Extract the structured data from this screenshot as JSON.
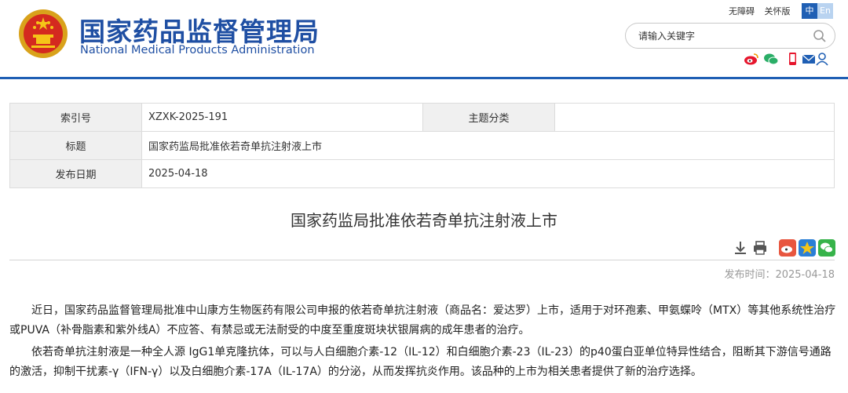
{
  "header": {
    "title_cn": "国家药品监督管理局",
    "title_en": "National Medical Products Administration",
    "emblem_icon": "national-emblem-icon",
    "links": [
      "无障碍",
      "关怀版"
    ],
    "lang_zh": "中",
    "lang_en": "En",
    "search_placeholder": "请输入关键字",
    "social_icons": [
      "weibo-icon",
      "wechat-icon",
      "mobile-icon",
      "mail-icon",
      "user-icon"
    ],
    "accent_color": "#1f5fb4"
  },
  "info": {
    "index_label": "索引号",
    "index_value": "XZXK-2025-191",
    "category_label": "主题分类",
    "category_value": "",
    "title_label": "标题",
    "title_value": "国家药监局批准依若奇单抗注射液上市",
    "date_label": "发布日期",
    "date_value": "2025-04-18"
  },
  "article": {
    "title": "国家药监局批准依若奇单抗注射液上市",
    "tool_icons": [
      "download-icon",
      "print-icon",
      "weibo-share-icon",
      "qzone-share-icon",
      "wechat-share-icon"
    ],
    "pub_date": "发布时间：2025-04-18",
    "paragraphs": [
      "近日，国家药品监督管理局批准中山康方生物医药有限公司申报的依若奇单抗注射液（商品名：爱达罗）上市，适用于对环孢素、甲氨蝶呤（MTX）等其他系统性治疗或PUVA（补骨脂素和紫外线A）不应答、有禁忌或无法耐受的中度至重度斑块状银屑病的成年患者的治疗。",
      "依若奇单抗注射液是一种全人源 IgG1单克隆抗体，可以与人白细胞介素-12（IL-12）和白细胞介素-23（IL-23）的p40蛋白亚单位特异性结合，阻断其下游信号通路的激活，抑制干扰素-γ（IFN-γ）以及白细胞介素-17A（IL-17A）的分泌，从而发挥抗炎作用。该品种的上市为相关患者提供了新的治疗选择。"
    ]
  }
}
